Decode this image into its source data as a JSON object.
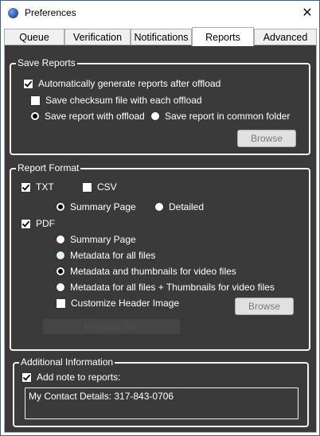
{
  "window": {
    "title": "Preferences",
    "close_glyph": "✕"
  },
  "tabs": [
    {
      "label": "Queue"
    },
    {
      "label": "Verification"
    },
    {
      "label": "Notifications"
    },
    {
      "label": "Reports",
      "active": true
    },
    {
      "label": "Advanced"
    }
  ],
  "save_reports": {
    "title": "Save Reports",
    "auto_generate": {
      "label": "Automatically generate reports after offload",
      "checked": true
    },
    "checksum_file": {
      "label": "Save checksum file with each offload",
      "checked": false
    },
    "save_with_offload": {
      "label": "Save report with offload",
      "selected": true
    },
    "save_common_folder": {
      "label": "Save report in common folder",
      "selected": false
    },
    "browse_label": "Browse"
  },
  "report_format": {
    "title": "Report Format",
    "txt": {
      "label": "TXT",
      "checked": true
    },
    "csv": {
      "label": "CSV",
      "checked": false
    },
    "txt_summary": {
      "label": "Summary Page",
      "selected": true
    },
    "txt_detailed": {
      "label": "Detailed",
      "selected": false
    },
    "pdf": {
      "label": "PDF",
      "checked": true
    },
    "pdf_summary": {
      "label": "Summary Page",
      "selected": false
    },
    "pdf_metadata_all": {
      "label": "Metadata for all files",
      "selected": false
    },
    "pdf_metadata_thumbs": {
      "label": "Metadata and thumbnails for video files",
      "selected": true
    },
    "pdf_metadata_all_thumbs": {
      "label": "Metadata for all files + Thumbnails for video files",
      "selected": false
    },
    "customize_header": {
      "label": "Customize Header Image",
      "checked": false
    },
    "browse_label": "Browse",
    "ghost_label": "Window Title"
  },
  "additional_info": {
    "title": "Additional Information",
    "add_note": {
      "label": "Add note to reports:",
      "checked": true
    },
    "note_text": "My Contact Details: 317-843-0706"
  },
  "colors": {
    "panel_bg": "#3a3a3a",
    "group_border": "#f2f2f2",
    "tab_bg": "#f0f0f0",
    "window_border": "#3f5f8f"
  }
}
